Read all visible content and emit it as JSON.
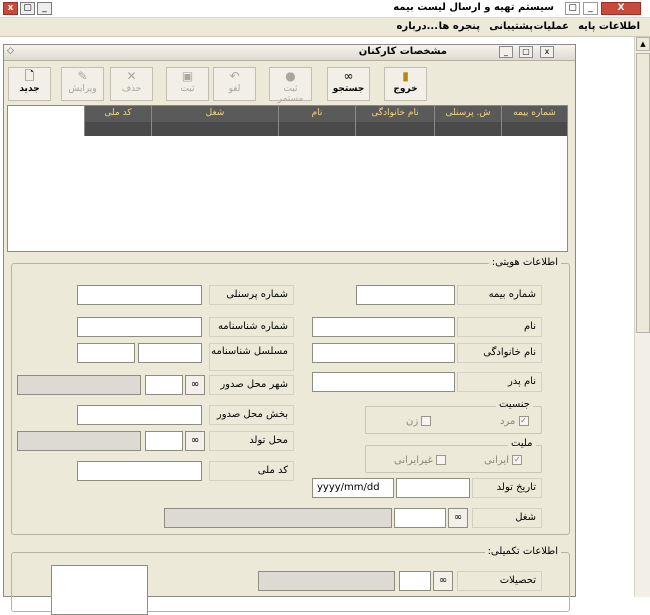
{
  "app": {
    "title": "سیستم تهیه و ارسال لیست بیمه"
  },
  "menu": [
    "اطلاعات پایه",
    "عملیات",
    "پشتیبانی",
    "پنجره ها",
    "درباره..."
  ],
  "window": {
    "title": "مشخصات کارکنان"
  },
  "toolbar": {
    "exit": "خروج",
    "search": "جستجو",
    "save_continuous": "ثبت مستمر",
    "cancel": "لغو",
    "save": "ثبت",
    "delete": "حذف",
    "edit": "ویرایش",
    "new": "جدید"
  },
  "grid": {
    "columns": [
      "شماره بیمه",
      "ش. پرسنلی",
      "نام خانوادگی",
      "نام",
      "شغل",
      "کد ملی"
    ]
  },
  "identity": {
    "legend": "اطلاعات هویتی:",
    "insurance_no": "شماره بیمه",
    "personnel_no": "شماره پرسنلی",
    "first_name": "نام",
    "id_number": "شماره شناسنامه",
    "last_name": "نام خانوادگی",
    "serial": "مسلسل شناسنامه",
    "father_name": "نام پدر",
    "issue_city": "شهر محل صدور",
    "gender_legend": "جنسیت",
    "male": "مرد",
    "female": "زن",
    "issue_district": "بخش محل صدور",
    "birth_place": "محل تولد",
    "nationality_legend": "ملیت",
    "iranian": "ایرانی",
    "non_iranian": "غیرایرانی",
    "national_code": "کد ملی",
    "birth_date": "تاریخ تولد",
    "birth_date_placeholder": "yyyy/mm/dd",
    "job": "شغل"
  },
  "extra": {
    "legend": "اطلاعات تکمیلی:",
    "education": "تحصیلات"
  }
}
